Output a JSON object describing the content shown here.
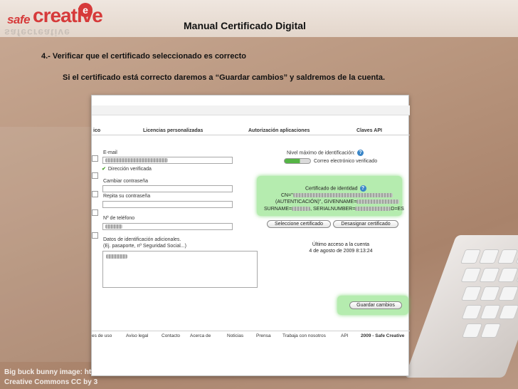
{
  "logo": {
    "safe": "safe",
    "creative": "creative",
    "mark": "e",
    "reflection": "safecreative"
  },
  "slide": {
    "title": "Manual Certificado Digital",
    "step_heading": "4.- Verificar que el certificado seleccionado es correcto",
    "step_text": "Si el certificado está correcto daremos a “Guardar cambios” y saldremos de la cuenta."
  },
  "tabs": [
    {
      "label": "ico"
    },
    {
      "label": "Licencias personalizadas"
    },
    {
      "label": "Autorización aplicaciones"
    },
    {
      "label": "Claves API"
    }
  ],
  "form": {
    "email_label": "E-mail",
    "verified_label": "Dirección verificada",
    "change_password_label": "Cambiar contraseña",
    "repeat_password_label": "Repita su contraseña",
    "phone_label": "Nº de teléfono",
    "id_data_label": "Datos de identificación adicionales.",
    "id_data_hint": "(Ej. pasaporte, nº Seguridad Social...)"
  },
  "identification": {
    "level_label": "Nivel máximo de identificación:",
    "toggle_label": "Correo electrónico verificado"
  },
  "certificate": {
    "title": "Certificado de identidad",
    "line1_prefix": "CN=\"",
    "line2": "(AUTENTICACIÓN)\", GIVENNAME=",
    "line3_prefix": "SURNAME=",
    "line3_mid": ", SERIALNUMBER=",
    "line3_suffix": "D=ES",
    "select_button": "Seleccione certificado",
    "unassign_button": "Desasignar certificado"
  },
  "last_access": {
    "label": "Último acceso a la cuenta",
    "datetime": "4 de agosto de 2009 8:13:24"
  },
  "save_button": "Guardar cambios",
  "footer": [
    "es de uso",
    "Aviso legal",
    "Contacto",
    "Acerca de",
    "Noticias",
    "Prensa",
    "Trabaja con nosotros",
    "API",
    "2009 - Safe Creative"
  ],
  "credits": {
    "line1": "Big buck bunny image: http",
    "line2": "Creative Commons CC by 3"
  },
  "colors": {
    "brand": "#d63a3a",
    "highlight": "#78dc6e",
    "help": "#3a86c8"
  }
}
